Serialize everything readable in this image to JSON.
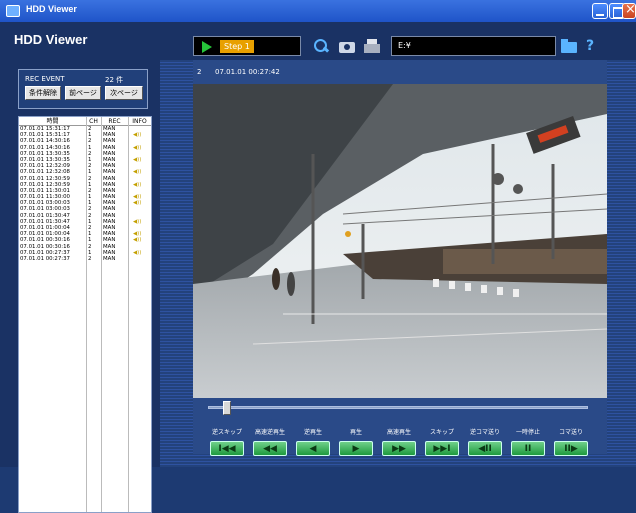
{
  "window": {
    "title": "HDD Viewer"
  },
  "header": {
    "app_name": "HDD Viewer",
    "step_label": "Step 1",
    "path": "E:¥",
    "icons": [
      "search-icon",
      "camera-icon",
      "printer-icon",
      "folder-icon",
      "help-icon"
    ]
  },
  "events": {
    "label": "REC EVENT",
    "count": "22 件",
    "btn_clear": "条件解除",
    "btn_prev": "前ページ",
    "btn_next": "次ページ",
    "columns": [
      "時間",
      "CH",
      "REC",
      "INFO"
    ],
    "rows": [
      {
        "time": "07.01.01 15:31:17",
        "ch": "2",
        "rec": "MAN",
        "info": ""
      },
      {
        "time": "07.01.01 15:31:17",
        "ch": "1",
        "rec": "MAN",
        "info": "◀))"
      },
      {
        "time": "07.01.01 14:30:16",
        "ch": "2",
        "rec": "MAN",
        "info": ""
      },
      {
        "time": "07.01.01 14:30:16",
        "ch": "1",
        "rec": "MAN",
        "info": "◀))"
      },
      {
        "time": "07.01.01 13:30:35",
        "ch": "2",
        "rec": "MAN",
        "info": ""
      },
      {
        "time": "07.01.01 13:30:35",
        "ch": "1",
        "rec": "MAN",
        "info": "◀))"
      },
      {
        "time": "07.01.01 12:32:09",
        "ch": "2",
        "rec": "MAN",
        "info": ""
      },
      {
        "time": "07.01.01 12:32:08",
        "ch": "1",
        "rec": "MAN",
        "info": "◀))"
      },
      {
        "time": "07.01.01 12:30:59",
        "ch": "2",
        "rec": "MAN",
        "info": ""
      },
      {
        "time": "07.01.01 12:30:59",
        "ch": "1",
        "rec": "MAN",
        "info": "◀))"
      },
      {
        "time": "07.01.01 11:30:01",
        "ch": "2",
        "rec": "MAN",
        "info": ""
      },
      {
        "time": "07.01.01 11:30:00",
        "ch": "1",
        "rec": "MAN",
        "info": "◀))"
      },
      {
        "time": "07.01.01 03:00:03",
        "ch": "1",
        "rec": "MAN",
        "info": "◀))"
      },
      {
        "time": "07.01.01 03:00:03",
        "ch": "2",
        "rec": "MAN",
        "info": ""
      },
      {
        "time": "07.01.01 01:30:47",
        "ch": "2",
        "rec": "MAN",
        "info": ""
      },
      {
        "time": "07.01.01 01:30:47",
        "ch": "1",
        "rec": "MAN",
        "info": "◀))"
      },
      {
        "time": "07.01.01 01:00:04",
        "ch": "2",
        "rec": "MAN",
        "info": ""
      },
      {
        "time": "07.01.01 01:00:04",
        "ch": "1",
        "rec": "MAN",
        "info": "◀))"
      },
      {
        "time": "07.01.01 00:30:16",
        "ch": "1",
        "rec": "MAN",
        "info": "◀))"
      },
      {
        "time": "07.01.01 00:30:16",
        "ch": "2",
        "rec": "MAN",
        "info": ""
      },
      {
        "time": "07.01.01 00:27:37",
        "ch": "1",
        "rec": "MAN",
        "info": "◀))"
      },
      {
        "time": "07.01.01 00:27:37",
        "ch": "2",
        "rec": "MAN",
        "info": ""
      }
    ]
  },
  "video": {
    "camera": "2",
    "timestamp": "07.01.01  00:27:42",
    "progress": 0.05
  },
  "controls": [
    {
      "name": "skip-back-button",
      "label": "逆スキップ",
      "glyph": "I◀◀"
    },
    {
      "name": "fast-rewind-button",
      "label": "高速逆再生",
      "glyph": "◀◀"
    },
    {
      "name": "reverse-play-button",
      "label": "逆再生",
      "glyph": "◀"
    },
    {
      "name": "play-button",
      "label": "再生",
      "glyph": "▶"
    },
    {
      "name": "fast-forward-button",
      "label": "高速再生",
      "glyph": "▶▶"
    },
    {
      "name": "skip-forward-button",
      "label": "スキップ",
      "glyph": "▶▶I"
    },
    {
      "name": "frame-back-button",
      "label": "逆コマ送り",
      "glyph": "◀II"
    },
    {
      "name": "pause-button",
      "label": "一時停止",
      "glyph": "II"
    },
    {
      "name": "frame-forward-button",
      "label": "コマ送り",
      "glyph": "II▶"
    }
  ]
}
